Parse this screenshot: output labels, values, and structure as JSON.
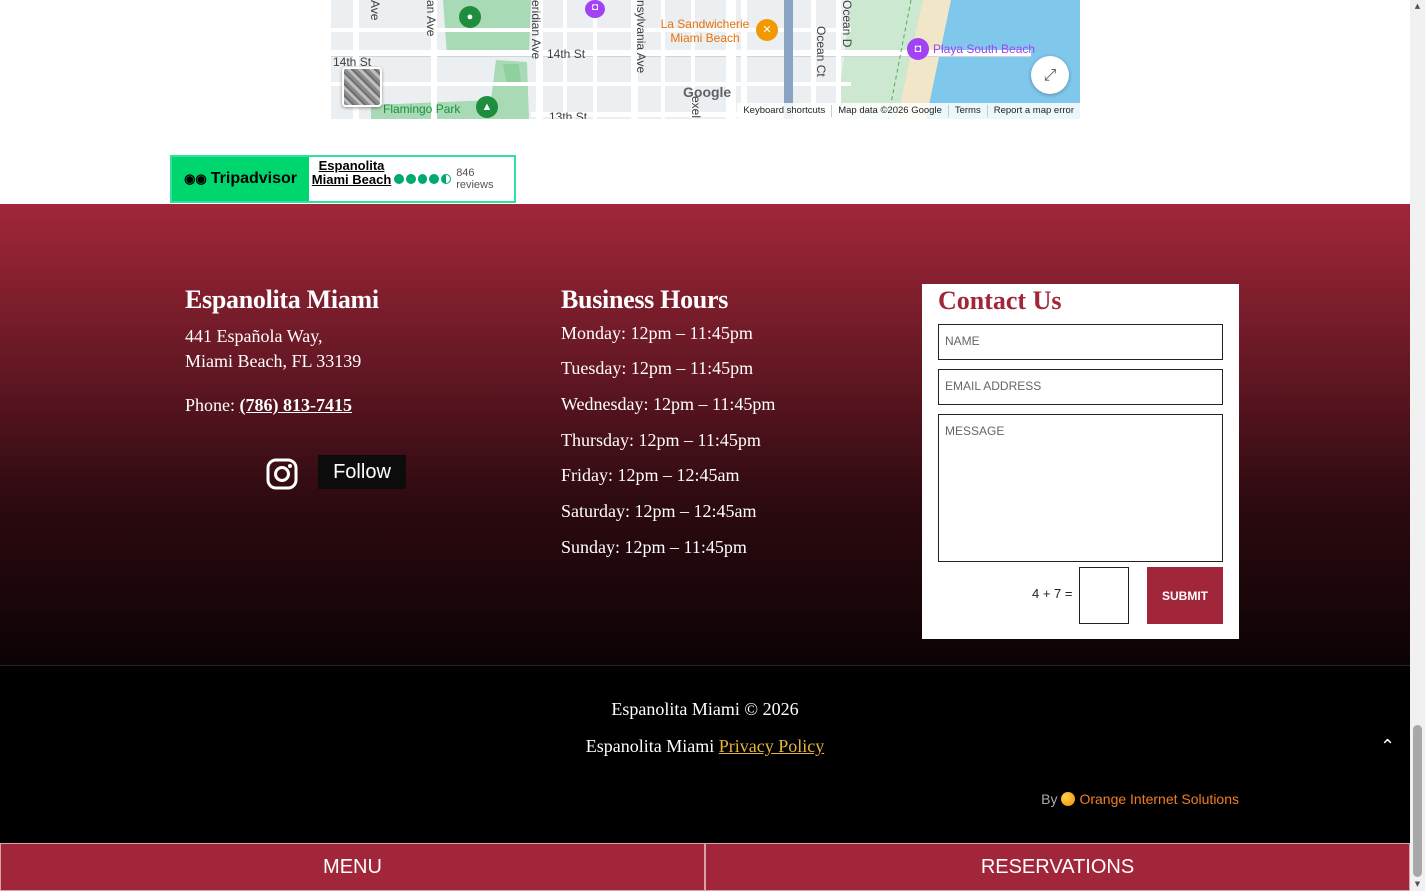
{
  "map": {
    "streets": {
      "fourteenth_left": "14th St",
      "fourteenth_mid": "14th St",
      "thirteenth": "13th St",
      "ave_left": "Ave",
      "an_ave": "an Ave",
      "meridian": "eridian Ave",
      "pennsylvania": "nsylvania Ave",
      "ocean_ct": "Ocean Ct",
      "ocean_dr": "Ocean D",
      "lexel": "exel"
    },
    "pois": {
      "sandwicherie": "La Sandwicherie Miami Beach",
      "playa": "Playa South Beach",
      "flamingo": "Flamingo Park"
    },
    "google_logo": "Google",
    "footer": {
      "shortcuts": "Keyboard shortcuts",
      "map_data": "Map data ©2026 Google",
      "terms": "Terms",
      "report": "Report a map error"
    }
  },
  "tripadvisor": {
    "logo_text": "Tripadvisor",
    "name": "Espanolita Miami Beach",
    "rating": 4.5,
    "reviews": "846 reviews"
  },
  "about": {
    "title": "Espanolita Miami",
    "address_line1": "441 Española Way,",
    "address_line2": "Miami Beach, FL 33139",
    "phone_label": "Phone:",
    "phone": "(786) 813-7415",
    "follow_label": "Follow"
  },
  "hours": {
    "title": "Business Hours",
    "days": [
      "Monday: 12pm – 11:45pm",
      "Tuesday: 12pm – 11:45pm",
      "Wednesday: 12pm – 11:45pm",
      "Thursday: 12pm – 11:45pm",
      "Friday: 12pm – 12:45am",
      "Saturday: 12pm – 12:45am",
      "Sunday: 12pm – 11:45pm"
    ]
  },
  "contact": {
    "title": "Contact Us",
    "name_placeholder": "NAME",
    "email_placeholder": "EMAIL ADDRESS",
    "message_placeholder": "MESSAGE",
    "captcha": "4 + 7 =",
    "submit_label": "SUBMIT"
  },
  "footer": {
    "copyright": "Espanolita Miami © 2026",
    "privacy_prefix": "Espanolita Miami",
    "privacy_link": "Privacy Policy",
    "by_label": "By",
    "by_company": "Orange Internet Solutions"
  },
  "bottom_bar": {
    "menu_label": "MENU",
    "reservations_label": "RESERVATIONS"
  },
  "colors": {
    "brand": "#a12639",
    "link": "#e6b43c",
    "company": "#f07d22"
  },
  "icons": {
    "instagram": "instagram-icon",
    "scroll_top": "chevron-up-icon",
    "fullscreen": "fullscreen-icon"
  }
}
